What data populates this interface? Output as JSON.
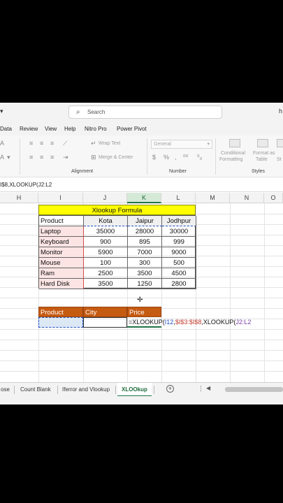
{
  "titlebar": {
    "left_text": "▾",
    "search_placeholder": "Search",
    "right_text": "h"
  },
  "menu": {
    "items": [
      "Data",
      "Review",
      "View",
      "Help",
      "Nitro Pro",
      "Power Pivot"
    ]
  },
  "ribbon": {
    "wrap_text": "Wrap Text",
    "merge_center": "Merge & Center",
    "number_format": "General",
    "conditional": "Conditional",
    "formatting": "Formatting",
    "format_as": "Format as",
    "table": "Table",
    "alignment_label": "Alignment",
    "number_label": "Number",
    "styles_label": "Styles",
    "st_label": "St"
  },
  "formula_bar": {
    "content": "I$8,XLOOKUP(J2:L2"
  },
  "columns": [
    "H",
    "I",
    "J",
    "K",
    "L",
    "M",
    "N",
    "O"
  ],
  "table": {
    "title": "Xlookup Formula",
    "headers": [
      "Product",
      "Kota",
      "Jaipur",
      "Jodhpur"
    ],
    "rows": [
      [
        "Laptop",
        "35000",
        "28000",
        "30000"
      ],
      [
        "Keyboard",
        "900",
        "895",
        "999"
      ],
      [
        "Monitor",
        "5900",
        "7000",
        "9000"
      ],
      [
        "Mouse",
        "100",
        "300",
        "500"
      ],
      [
        "Ram",
        "2500",
        "3500",
        "4500"
      ],
      [
        "Hard Disk",
        "3500",
        "1250",
        "2800"
      ]
    ]
  },
  "lookup": {
    "headers": [
      "Product",
      "City",
      "Price"
    ],
    "formula": {
      "prefix": "=XLOOKUP(",
      "ref1": "I12",
      "sep1": ",",
      "ref2": "$I$3:$I$8",
      "mid": ",XLOOKUP(",
      "ref3": "J2:L2"
    }
  },
  "sheet_tabs": [
    "ose",
    "Count Blank",
    "Iferror and Vlookup",
    "XLOOkup"
  ],
  "colors": {
    "title_fill": "#ffff00",
    "header_fill": "#c55a11",
    "product_fill": "#fce4e4",
    "city_header_fill": "#f0f0f0",
    "accent_green": "#217346",
    "ref_blue": "#1f4fbf",
    "ref_red": "#c0392b",
    "ref_purple": "#7b3fa8"
  }
}
